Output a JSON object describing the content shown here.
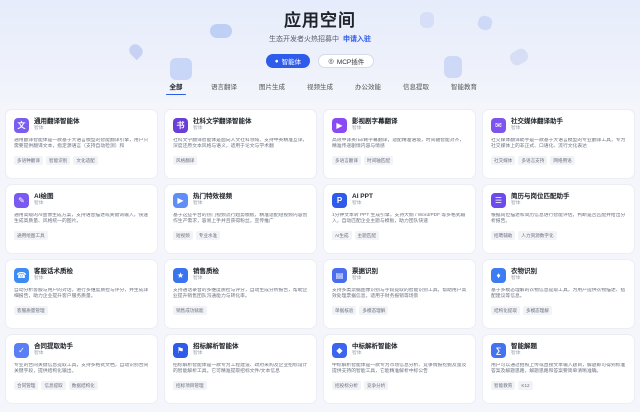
{
  "page": {
    "title": "应用空间",
    "subtitle_text": "生态开发者火热招募中",
    "subtitle_link": "申请入驻"
  },
  "toggles": [
    {
      "label": "智能体",
      "icon": "robot-icon",
      "active": true
    },
    {
      "label": "MCP插件",
      "icon": "plugin-icon",
      "active": false
    }
  ],
  "tabs": [
    "全部",
    "语言翻译",
    "图片生成",
    "视频生成",
    "办公效能",
    "信息提取",
    "智能教育"
  ],
  "cards": [
    {
      "name": "通用翻译智能体",
      "type": "智体",
      "icon": "translate-icon",
      "color": "#7b5cf0",
      "desc": "通用翻译智能体是一款基于大语言模型的智能翻译引擎，用户只需要提供翻译文本，指定源语言（支持自动检测）和",
      "tags": [
        "多语种翻译",
        "智能识别",
        "文化适配"
      ]
    },
    {
      "name": "社科文学翻译智能体",
      "type": "智体",
      "icon": "book-icon",
      "color": "#6a3fd8",
      "desc": "社科文学翻译智能体是面向人文社科领域、支持中英精准互译，深度还原文本风格与语义，适用于论文与学术翻",
      "tags": [
        "风格翻译"
      ]
    },
    {
      "name": "影视剧字幕翻译",
      "type": "智体",
      "icon": "film-icon",
      "color": "#8a4af3",
      "desc": "高效中译英/日/韩字幕翻译，适配精准语境，时间轴智能对齐，精准传递剧情内容与情感",
      "tags": [
        "多语言翻译",
        "时间轴匹配"
      ]
    },
    {
      "name": "社交媒体翻译助手",
      "type": "智体",
      "icon": "chat-icon",
      "color": "#7d55ee",
      "desc": "社交媒体翻译助手是一款基于大语言模型的专业翻译工具，专为社交媒体上的非正式、口语化、流行文化表达",
      "tags": [
        "社交媒体",
        "多语言支持",
        "网络用语"
      ]
    },
    {
      "name": "AI绘图",
      "type": "智体",
      "icon": "paint-icon",
      "color": "#7a58f2",
      "desc": "通用高级的AI图像生成方案，支持语音描述或关键词输入，快速生成高质量、风格统一的图片。",
      "tags": [
        "通用绘图工具"
      ]
    },
    {
      "name": "热门特效视频",
      "type": "智体",
      "icon": "video-icon",
      "color": "#5f8ef7",
      "desc": "基于这些平台的热门视频流行趋势模板，精准适配短视频内容创作生产需求，容易上手并且获得粉丝，宣传推广",
      "tags": [
        "短视频",
        "专业水准"
      ]
    },
    {
      "name": "AI PPT",
      "type": "智体",
      "icon": "ppt-icon",
      "color": "#2f5bea",
      "desc": "1分钟文本转 PPT 生成引擎，支持大纲 / Word/PDF 等多格式输入，自动匹配企业主题与模板，助力团队快速",
      "tags": [
        "AI生成",
        "主题匹配"
      ]
    },
    {
      "name": "简历与岗位匹配助手",
      "type": "智体",
      "icon": "resume-icon",
      "color": "#6c4be8",
      "desc": "根据岗位描述和简历信息进行智能评估，判断是否匹配并给出分析报告。",
      "tags": [
        "招聘辅助",
        "人力资源数字化"
      ]
    },
    {
      "name": "客服话术质检",
      "type": "智体",
      "icon": "headset-icon",
      "color": "#3c8cf4",
      "desc": "自动分析客服与用户的对话，进行多维度质检与评分，并生成详细报告，助力企业提升客户服务质量。",
      "tags": [
        "客服质量管理"
      ]
    },
    {
      "name": "销售质检",
      "type": "智体",
      "icon": "sales-icon",
      "color": "#3a73f0",
      "desc": "支持通话录音的多维度质检与评分，自动生成分析报告，帮助企业提升销售团队沟通能力与转化率。",
      "tags": [
        "销售成功赋能"
      ]
    },
    {
      "name": "票据识别",
      "type": "智体",
      "icon": "receipt-icon",
      "color": "#4a6df0",
      "desc": "支持多类票据图像识别与字段提取的智能识别工具，帮助用户高效处理票据信息，适用于财务报销等场景",
      "tags": [
        "单据核验",
        "多模态理解"
      ]
    },
    {
      "name": "衣物识别",
      "type": "智体",
      "icon": "shirt-icon",
      "color": "#3e7cf2",
      "desc": "基于多模态理解的衣物信息提取工具，为用户提供衣物描述、搭配建议等信息。",
      "tags": [
        "结构化提取",
        "多模态理解"
      ]
    },
    {
      "name": "合同提取助手",
      "type": "智体",
      "icon": "contract-icon",
      "color": "#5a7ff5",
      "desc": "专业的合同关键信息提取工具，支持多格式文档，自动识别合同关键字段，提供结构化输出。",
      "tags": [
        "合同管理",
        "信息提取",
        "数据结构化"
      ]
    },
    {
      "name": "招标解析智能体",
      "type": "智体",
      "icon": "bid-icon",
      "color": "#2f5bea",
      "desc": "招标解析智能体是一款专为工程建设、政府采购及企业招标设计的智能解析工具，它可精准提取招标文件/文本信息",
      "tags": [
        "招标项目管理"
      ]
    },
    {
      "name": "中标解析智能体",
      "type": "智体",
      "icon": "award-icon",
      "color": "#3d64ee",
      "desc": "中标解析智能体是一款专为市场信息分析、竞争情报挖掘及量及提供支持的智能工具，它能精准解析中标公告",
      "tags": [
        "招投标分析",
        "竞争分析"
      ]
    },
    {
      "name": "智能解题",
      "type": "智体",
      "icon": "math-icon",
      "color": "#4472f0",
      "desc": "用户可以通过拍照上传或直接文本输入题目，解题即可得到标准答案及解题思路，解题思路和答案要简单清晰准确。",
      "tags": [
        "智能教育",
        "K12"
      ]
    }
  ]
}
